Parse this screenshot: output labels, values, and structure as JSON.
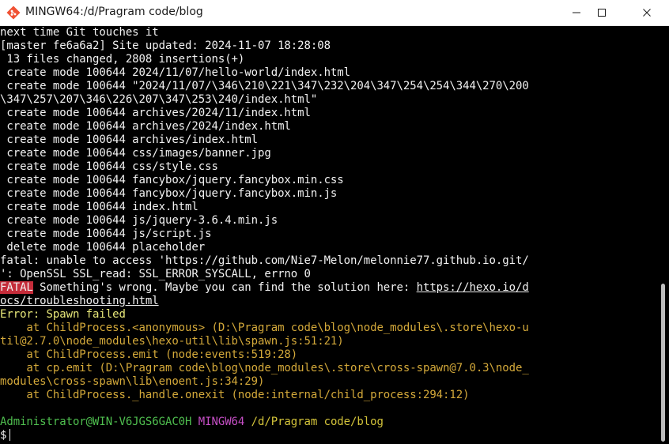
{
  "window": {
    "title": "MINGW64:/d/Pragram code/blog",
    "icon": "git-bash-icon"
  },
  "terminal": {
    "lines": [
      "next time Git touches it",
      "[master fe6a6a2] Site updated: 2024-11-07 18:28:08",
      " 13 files changed, 2808 insertions(+)",
      " create mode 100644 2024/11/07/hello-world/index.html",
      " create mode 100644 \"2024/11/07/\\346\\210\\221\\347\\232\\204\\347\\254\\254\\344\\270\\200",
      "\\347\\257\\207\\346\\226\\207\\347\\253\\240/index.html\"",
      " create mode 100644 archives/2024/11/index.html",
      " create mode 100644 archives/2024/index.html",
      " create mode 100644 archives/index.html",
      " create mode 100644 css/images/banner.jpg",
      " create mode 100644 css/style.css",
      " create mode 100644 fancybox/jquery.fancybox.min.css",
      " create mode 100644 fancybox/jquery.fancybox.min.js",
      " create mode 100644 index.html",
      " create mode 100644 js/jquery-3.6.4.min.js",
      " create mode 100644 js/script.js",
      " delete mode 100644 placeholder",
      "fatal: unable to access 'https://github.com/Nie7-Melon/melonnie77.github.io.git/",
      "': OpenSSL SSL_read: SSL_ERROR_SYSCALL, errno 0"
    ],
    "fatal": {
      "badge": "FATAL",
      "message": " Something's wrong. Maybe you can find the solution here: ",
      "link_part1": "https://hexo.io/d",
      "link_part2": "ocs/troubleshooting.html"
    },
    "error_line": "Error: Spawn failed",
    "stack_lines": [
      "    at ChildProcess.<anonymous> (D:\\Pragram code\\blog\\node_modules\\.store\\hexo-u",
      "til@2.7.0\\node_modules\\hexo-util\\lib\\spawn.js:51:21)",
      "    at ChildProcess.emit (node:events:519:28)",
      "    at cp.emit (D:\\Pragram code\\blog\\node_modules\\.store\\cross-spawn@7.0.3\\node_",
      "modules\\cross-spawn\\lib\\enoent.js:34:29)",
      "    at ChildProcess._handle.onexit (node:internal/child_process:294:12)"
    ],
    "prompt": {
      "user_host": "Administrator@WIN-V6JGS6GAC0H",
      "env": "MINGW64",
      "path": "/d/Pragram code/blog",
      "symbol": "$"
    }
  }
}
